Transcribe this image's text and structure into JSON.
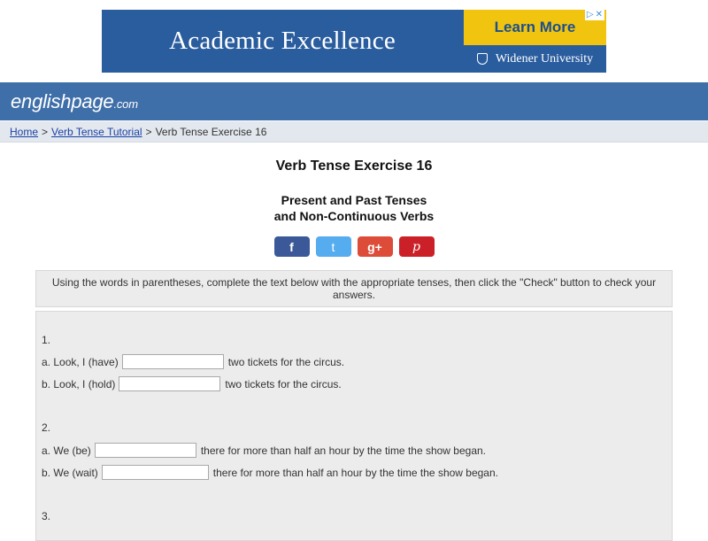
{
  "ad": {
    "headline": "Academic Excellence",
    "cta_label": "Learn More",
    "brand": "Widener University",
    "choices_glyphs": [
      "▷",
      "✕"
    ]
  },
  "site": {
    "logo_name": "englishpage",
    "logo_tld": ".com"
  },
  "breadcrumb": {
    "home": "Home",
    "tutorial": "Verb Tense Tutorial",
    "current": "Verb Tense Exercise 16",
    "separator": ">"
  },
  "page": {
    "title": "Verb Tense Exercise 16",
    "subtitle_line1": "Present and Past Tenses",
    "subtitle_line2": "and Non-Continuous Verbs"
  },
  "social": {
    "facebook": "f",
    "twitter": "t",
    "googleplus": "g+",
    "pinterest": "p"
  },
  "instructions": "Using the words in parentheses, complete the text below with the appropriate tenses, then click the \"Check\" button to check your answers.",
  "questions": [
    {
      "number": "1.",
      "a_prompt": "a. Look, I (have)",
      "a_value": "",
      "a_rest": "two tickets for the circus.",
      "b_prompt": "b. Look, I (hold)",
      "b_value": "",
      "b_rest": "two tickets for the circus."
    },
    {
      "number": "2.",
      "a_prompt": "a. We (be)",
      "a_value": "",
      "a_rest": "there for more than half an hour by the time the show began.",
      "b_prompt": "b. We (wait)",
      "b_value": "",
      "b_rest": "there for more than half an hour by the time the show began."
    },
    {
      "number": "3."
    }
  ],
  "colors": {
    "header_blue": "#3f6fa9",
    "ad_blue": "#2a5d9e",
    "ad_yellow": "#f1c40f",
    "link_blue": "#1a3fa5",
    "panel_gray": "#ececec"
  }
}
